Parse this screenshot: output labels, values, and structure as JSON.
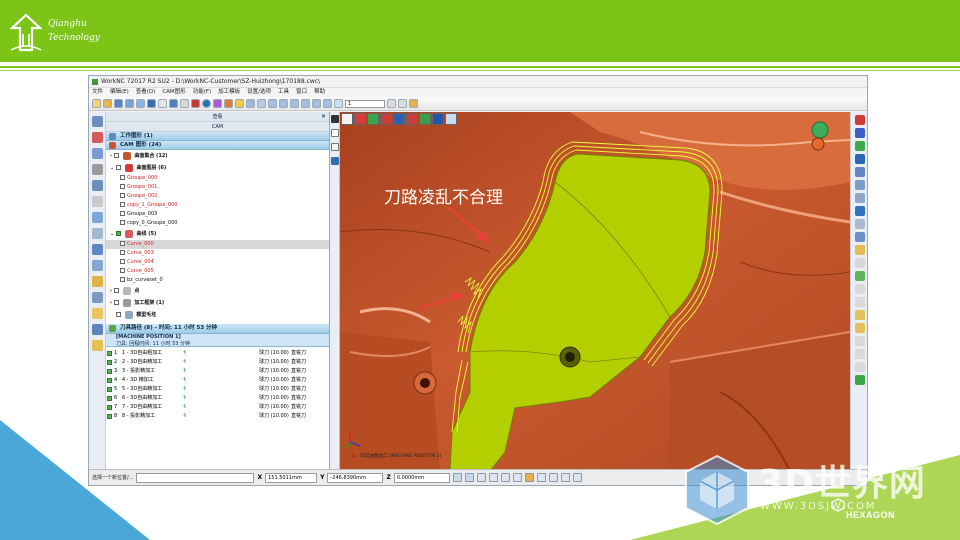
{
  "brand": {
    "line1": "Qianghu",
    "line2": "Technology"
  },
  "app": {
    "title": "WorkNC 72017 R2 SU2 - D:\\WorkNC-Customer\\SZ-Huizhong\\170188.cwc\\",
    "menu": [
      "文件",
      "编辑(E)",
      "查看(D)",
      "CAM图形",
      "功能(F)",
      "加工模板",
      "设置/选项",
      "工具",
      "窗口",
      "帮助"
    ],
    "toolbar_combo": "1"
  },
  "panel": {
    "header_view": "查看",
    "header_cam": "CAM",
    "section_work": "工作图形 (1)",
    "section_cam": "CAM 图形 (24)",
    "groups": [
      {
        "label": "曲面集合 (12)",
        "color": "#c0582e",
        "checked": false
      },
      {
        "label": "曲面图层 (6)",
        "color": "#d43b3b",
        "checked": false
      }
    ],
    "surface_items": [
      {
        "label": "Groupe_000",
        "red": true
      },
      {
        "label": "Groupe_001",
        "red": true
      },
      {
        "label": "Groupe_002",
        "red": true
      },
      {
        "label": "copy_1_Groupe_000",
        "red": true
      },
      {
        "label": "Groupe_003",
        "red": false
      },
      {
        "label": "copy_0_Groupe_000",
        "red": false
      }
    ],
    "curve_group": "曲线 (5)",
    "curve_items": [
      {
        "label": "Curve_000",
        "red": true
      },
      {
        "label": "Curve_003",
        "red": true
      },
      {
        "label": "Curve_004",
        "red": true
      },
      {
        "label": "Curve_005",
        "red": true
      },
      {
        "label": "bz_curveset_0",
        "red": false
      }
    ],
    "group_point": "点",
    "group_frame": "加工框架 (1)",
    "group_stock": "模型毛坯",
    "toolpath_section": "刀具路径 (8) - 时间: 11 小时 53 分钟",
    "machine_position": "[MACHINE POSITION 1]",
    "machine_sub": "刀具: 回程时间: 11 小时 53 分钟",
    "toolpaths": [
      {
        "num": "1",
        "name": "1 - 3D自由粗加工",
        "tool": "球刀 (10.00)",
        "opt": "直铣刀"
      },
      {
        "num": "2",
        "name": "2 - 3D自由精加工",
        "tool": "球刀 (10.00)",
        "opt": "直铣刀"
      },
      {
        "num": "3",
        "name": "3 - 投影精加工",
        "tool": "球刀 (10.00)",
        "opt": "直铣刀"
      },
      {
        "num": "4",
        "name": "4 - 3D 精加工",
        "tool": "球刀 (10.00)",
        "opt": "直铣刀"
      },
      {
        "num": "5",
        "name": "5 - 3D自由精加工",
        "tool": "球刀 (10.00)",
        "opt": "直铣刀"
      },
      {
        "num": "6",
        "name": "6 - 3D自由精加工",
        "tool": "球刀 (10.00)",
        "opt": "直铣刀"
      },
      {
        "num": "7",
        "name": "7 - 3D自由精加工",
        "tool": "球刀 (10.00)",
        "opt": "直铣刀"
      },
      {
        "num": "8",
        "name": "8 - 投影精加工",
        "tool": "球刀 (10.00)",
        "opt": "直铣刀"
      }
    ]
  },
  "viewport": {
    "annotation": "刀路凌乱不合理",
    "gizmo_label": "1 - 3D自由粗加工 [MACHINE POSITION 1]",
    "colors": {
      "part": "#c4542b",
      "part_light": "#e9875a",
      "part_dark": "#8e3519",
      "highlight": "#b8d400",
      "toolpath": "#eaff3a",
      "arrow": "#e8413a"
    }
  },
  "status": {
    "prompt": "选择一个新位置/...",
    "x_label": "X",
    "x_value": "151.5011mm",
    "y_label": "Y",
    "y_value": "-246.8390mm",
    "z_label": "Z",
    "z_value": "0.0000mm"
  },
  "watermark": {
    "text": "3D世界网",
    "url": "WWW.3DSJW.COM",
    "hexagon": "HEXAGON"
  }
}
